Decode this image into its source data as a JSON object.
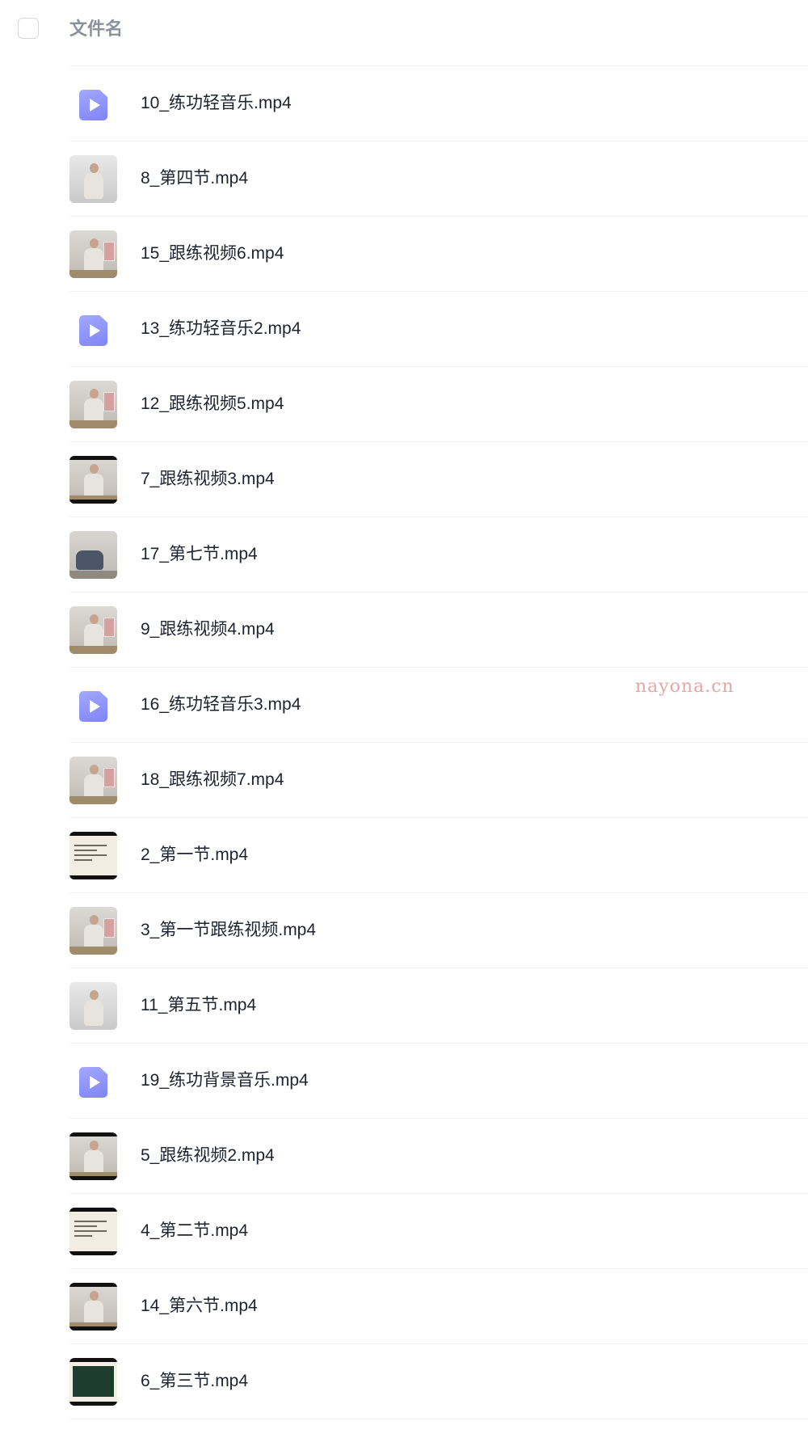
{
  "header": {
    "column_title": "文件名"
  },
  "files": [
    {
      "name": "10_练功轻音乐.mp4",
      "thumb": "audio-file-icon"
    },
    {
      "name": "8_第四节.mp4",
      "thumb": "video-thumbnail"
    },
    {
      "name": "15_跟练视频6.mp4",
      "thumb": "video-thumbnail"
    },
    {
      "name": "13_练功轻音乐2.mp4",
      "thumb": "audio-file-icon"
    },
    {
      "name": "12_跟练视频5.mp4",
      "thumb": "video-thumbnail"
    },
    {
      "name": "7_跟练视频3.mp4",
      "thumb": "video-thumbnail"
    },
    {
      "name": "17_第七节.mp4",
      "thumb": "video-thumbnail"
    },
    {
      "name": "9_跟练视频4.mp4",
      "thumb": "video-thumbnail"
    },
    {
      "name": "16_练功轻音乐3.mp4",
      "thumb": "audio-file-icon"
    },
    {
      "name": "18_跟练视频7.mp4",
      "thumb": "video-thumbnail"
    },
    {
      "name": "2_第一节.mp4",
      "thumb": "video-thumbnail"
    },
    {
      "name": "3_第一节跟练视频.mp4",
      "thumb": "video-thumbnail"
    },
    {
      "name": "11_第五节.mp4",
      "thumb": "video-thumbnail"
    },
    {
      "name": "19_练功背景音乐.mp4",
      "thumb": "audio-file-icon"
    },
    {
      "name": "5_跟练视频2.mp4",
      "thumb": "video-thumbnail"
    },
    {
      "name": "4_第二节.mp4",
      "thumb": "video-thumbnail"
    },
    {
      "name": "14_第六节.mp4",
      "thumb": "video-thumbnail"
    },
    {
      "name": "6_第三节.mp4",
      "thumb": "video-thumbnail"
    }
  ],
  "watermark": "nayona.cn",
  "colors": {
    "file_icon_accent": "#8f93fb",
    "text_primary": "#1f2330",
    "header_text": "#8a8f99",
    "divider": "#eef0f3",
    "watermark": "#e6a6a6"
  }
}
